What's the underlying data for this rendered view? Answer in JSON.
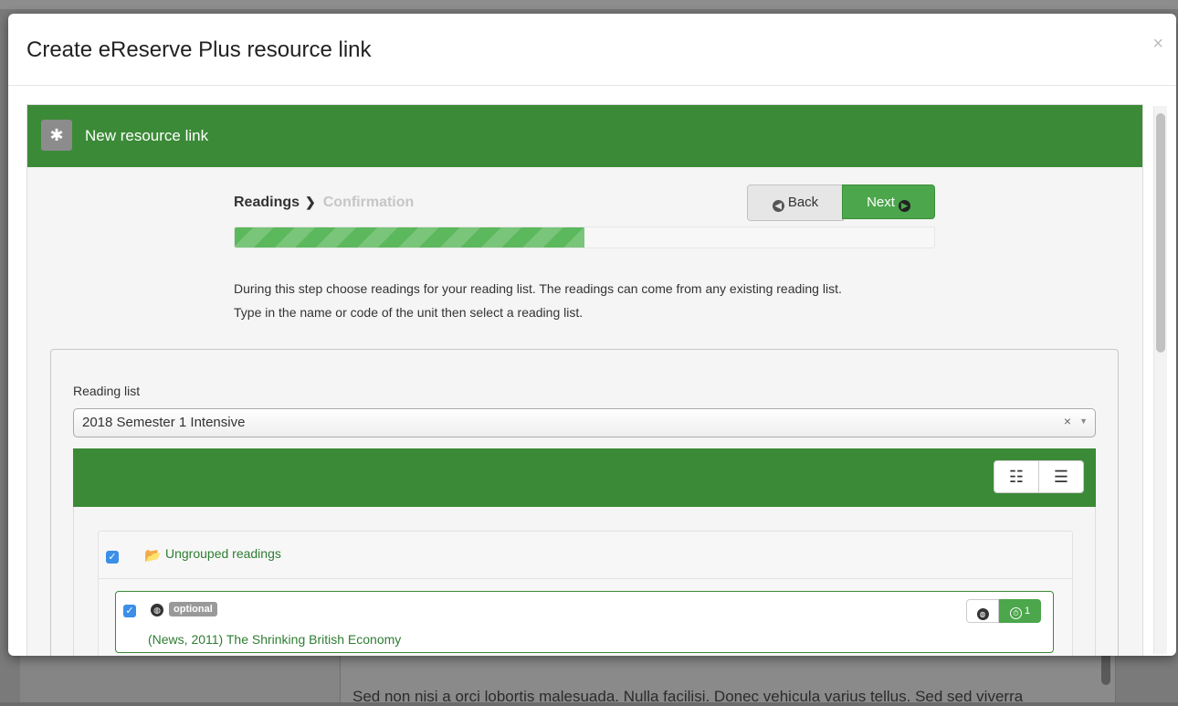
{
  "background": {
    "text": "Sed non nisi a orci lobortis malesuada. Nulla facilisi. Donec vehicula varius tellus. Sed sed viverra"
  },
  "modal": {
    "title": "Create eReserve Plus resource link",
    "close_label": "×"
  },
  "panel": {
    "heading_title": "New resource link",
    "heading_icon": "asterisk-icon"
  },
  "wizard": {
    "steps": [
      {
        "label": "Readings",
        "active": true
      },
      {
        "label": "Confirmation",
        "active": false
      }
    ],
    "back_label": "Back",
    "next_label": "Next",
    "progress_percent": 50,
    "instructions": [
      "During this step choose readings for your reading list. The readings can come from any existing reading list.",
      "Type in the name or code of the unit then select a reading list."
    ]
  },
  "reading_list": {
    "label": "Reading list",
    "selected": "2018 Semester 1 Intensive",
    "clear_icon": "×",
    "arrow_icon": "▼"
  },
  "view_toggle": {
    "icons": [
      "list-detailed-icon",
      "list-compact-icon"
    ]
  },
  "group": {
    "checked": true,
    "label": "Ungrouped readings",
    "icon": "folder-open-icon"
  },
  "readings": [
    {
      "checked": true,
      "badge": "optional",
      "title": "(News, 2011) The Shrinking British Economy",
      "count": "1"
    }
  ],
  "colors": {
    "brand_green": "#3b8a37",
    "button_green": "#4ca64c",
    "link_green": "#2e7d32",
    "checkbox_blue": "#3b8fe6"
  }
}
